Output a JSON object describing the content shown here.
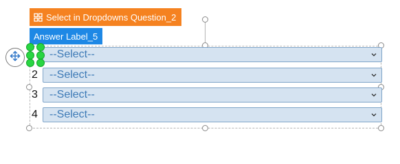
{
  "question_tag": {
    "label": "Select in Dropdowns Question_2",
    "icon": "grid-icon",
    "color": "#f58220"
  },
  "answer_tag": {
    "label": "Answer Label_5",
    "color": "#1e88e5"
  },
  "move_handle": {
    "icon": "move-arrows-icon"
  },
  "rows": [
    {
      "number": "",
      "placeholder": "--Select--"
    },
    {
      "number": "2",
      "placeholder": "--Select--"
    },
    {
      "number": "3",
      "placeholder": "--Select--"
    },
    {
      "number": "4",
      "placeholder": "--Select--"
    }
  ],
  "colors": {
    "dropdown_fill": "#d5e3f1",
    "dropdown_border": "#7fa4c8",
    "dropdown_text": "#3d7ab6",
    "selection_handle": "#29d642"
  }
}
